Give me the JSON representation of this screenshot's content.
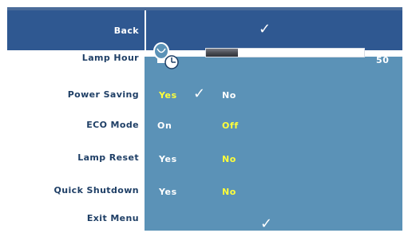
{
  "menu": {
    "back_label": "Back",
    "rows": [
      {
        "label": "Lamp Hour"
      },
      {
        "label": "Power Saving",
        "options": [
          "Yes",
          "No"
        ]
      },
      {
        "label": "ECO Mode",
        "options": [
          "On",
          "Off"
        ]
      },
      {
        "label": "Lamp Reset",
        "options": [
          "Yes",
          "No"
        ]
      },
      {
        "label": "Quick Shutdown",
        "options": [
          "Yes",
          "No"
        ]
      },
      {
        "label": "Exit Menu"
      }
    ],
    "lamp_hour_value": "50",
    "lamp_hour_progress": 0.2
  },
  "icons": {
    "check": "checkmark-icon",
    "lamp": "lamp-clock-icon"
  },
  "colors": {
    "header_bg": "#2f5891",
    "panel_bg": "#5b92b7",
    "label_text": "#1f3f66",
    "highlight": "#ffff3a"
  }
}
